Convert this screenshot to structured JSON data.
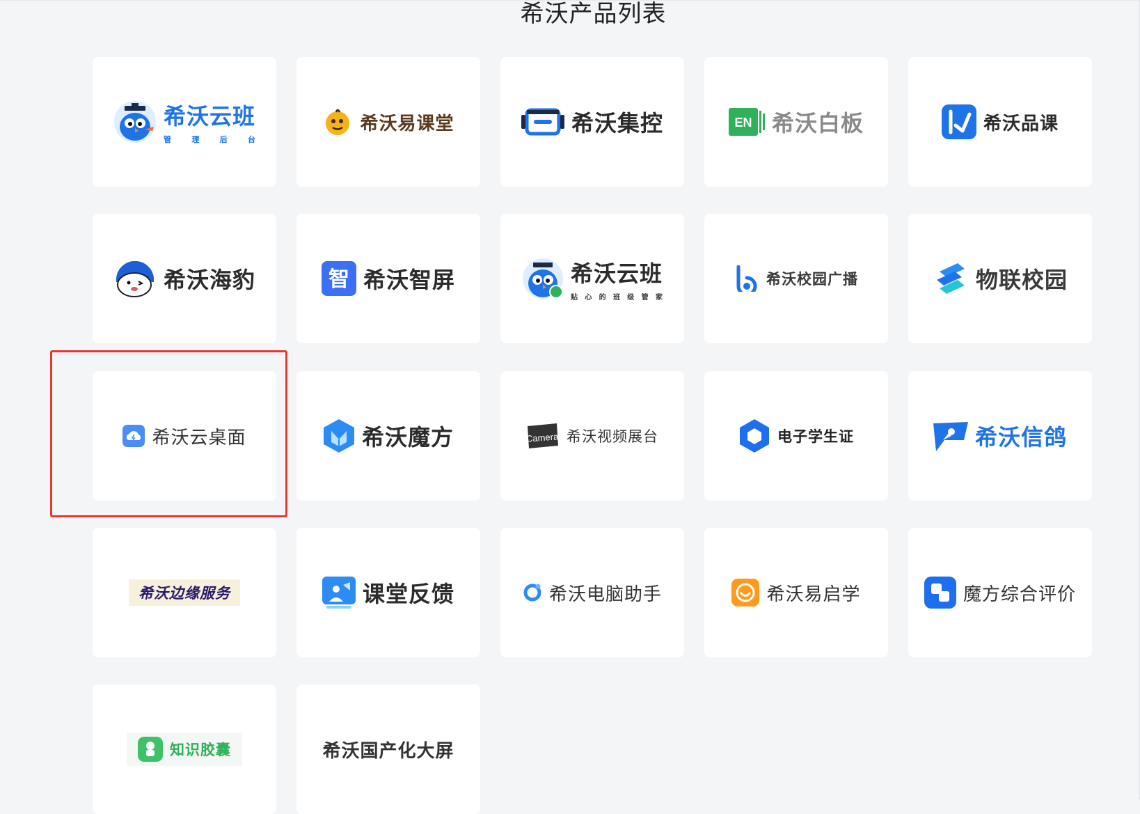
{
  "page": {
    "title": "希沃产品列表"
  },
  "products": [
    {
      "name": "希沃云班",
      "subtitle": [
        "管",
        "理",
        "后",
        "台"
      ],
      "color": "#1e73e8",
      "icon": "owl-mascot-icon"
    },
    {
      "name": "希沃易课堂",
      "color": "#5b3a1e",
      "icon": "chick-mascot-icon"
    },
    {
      "name": "希沃集控",
      "color": "#2b2b2b",
      "icon": "screen-control-icon"
    },
    {
      "name": "希沃白板",
      "color": "#8a8a8a",
      "icon": "en-board-icon"
    },
    {
      "name": "希沃品课",
      "color": "#2b2b2b",
      "icon": "play-k-icon"
    },
    {
      "name": "希沃海豹",
      "color": "#2b2b2b",
      "icon": "seal-mascot-icon"
    },
    {
      "name": "希沃智屏",
      "color": "#2b2b2b",
      "icon": "zhi-screen-icon"
    },
    {
      "name": "希沃云班",
      "subtitle": [
        "贴",
        "心",
        "的",
        "班",
        "级",
        "管",
        "家"
      ],
      "color": "#2b2b2b",
      "icon": "owl-miniprogram-icon"
    },
    {
      "name": "希沃校园广播",
      "color": "#3a3a3a",
      "icon": "broadcast-b-icon"
    },
    {
      "name": "物联校园",
      "color": "#3a3a3a",
      "icon": "iot-layers-icon"
    },
    {
      "name": "希沃云桌面",
      "color": "#333333",
      "icon": "cloud-desktop-icon",
      "highlighted": true
    },
    {
      "name": "希沃魔方",
      "color": "#2b2b2b",
      "icon": "magic-cube-icon"
    },
    {
      "name": "希沃视频展台",
      "color": "#333333",
      "icon": "camera-badge-icon",
      "badge_text": "Camera"
    },
    {
      "name": "电子学生证",
      "color": "#222222",
      "icon": "hexagon-id-icon"
    },
    {
      "name": "希沃信鸽",
      "color": "#1e73e8",
      "icon": "pigeon-flag-icon"
    },
    {
      "name": "希沃边缘服务",
      "color": "#2a1b6b",
      "icon": ""
    },
    {
      "name": "课堂反馈",
      "color": "#2b2b2b",
      "icon": "feedback-person-icon"
    },
    {
      "name": "希沃电脑助手",
      "color": "#333333",
      "icon": "ring-assistant-icon"
    },
    {
      "name": "希沃易启学",
      "color": "#333333",
      "icon": "smile-orange-icon"
    },
    {
      "name": "魔方综合评价",
      "color": "#333333",
      "icon": "blue-squares-icon"
    },
    {
      "name": "知识胶囊",
      "color": "#2fb05a",
      "icon": "capsule-green-icon"
    },
    {
      "name": "希沃国产化大屏",
      "color": "#333333",
      "icon": ""
    }
  ]
}
